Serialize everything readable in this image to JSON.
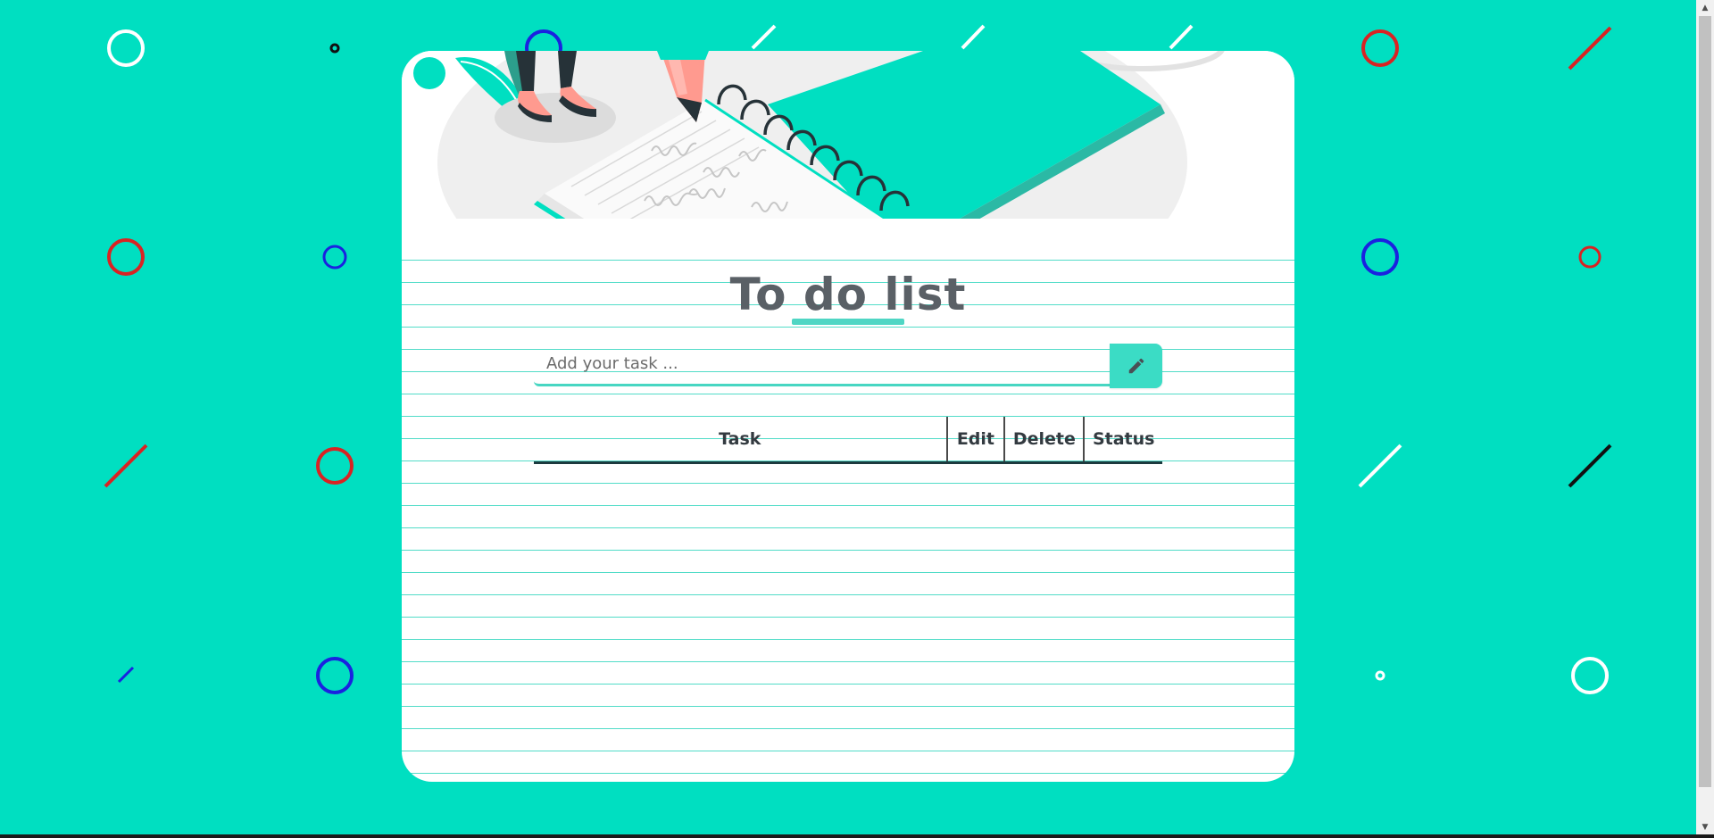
{
  "app": {
    "title": "To do list"
  },
  "form": {
    "input_placeholder": "Add your task ...",
    "input_value": "",
    "add_icon": "pencil-icon"
  },
  "table": {
    "headers": {
      "task": "Task",
      "edit": "Edit",
      "delete": "Delete",
      "status": "Status"
    },
    "rows": []
  },
  "colors": {
    "background": "#00dfc1",
    "accent": "#3bdcc5",
    "title_text": "#5a6066",
    "ruled_line": "#52dcc8",
    "deco_red": "#d92323",
    "deco_blue": "#1a22e0",
    "deco_white": "#ffffff",
    "deco_black": "#111111"
  },
  "decorations": {
    "background_pattern": "circles-and-slashes",
    "hero_illustration": "person-writing-on-spiral-notebook"
  }
}
